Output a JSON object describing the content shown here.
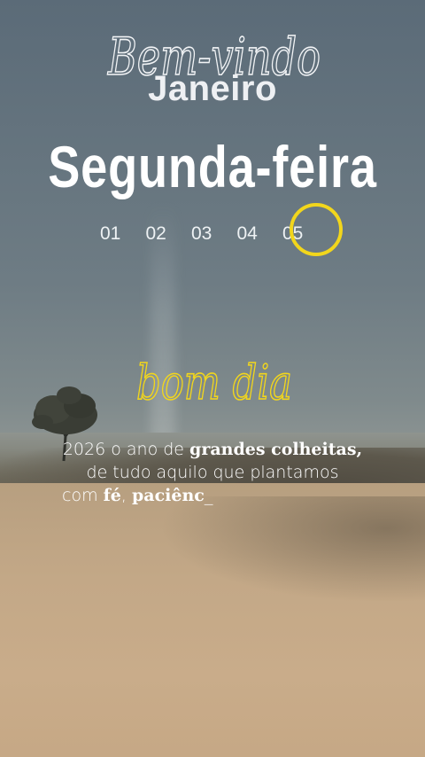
{
  "header": {
    "welcome": "Bem-vindo",
    "month": "Janeiro",
    "weekday": "Segunda-feira"
  },
  "calendar": {
    "days": [
      "01",
      "02",
      "03",
      "04",
      "05"
    ],
    "highlighted_day": "05",
    "highlight_color": "#f2d61c"
  },
  "greeting": {
    "text": "bom dia",
    "color": "#f2d61c"
  },
  "message": {
    "line1_prefix": "2026 o ano de ",
    "line1_bold": "grandes colheitas,",
    "line2": "de tudo aquilo que plantamos",
    "line3_prefix": "com ",
    "line3_bold1": "fé",
    "line3_sep": ", ",
    "line3_bold2": "paciênc",
    "cursor": "_"
  }
}
